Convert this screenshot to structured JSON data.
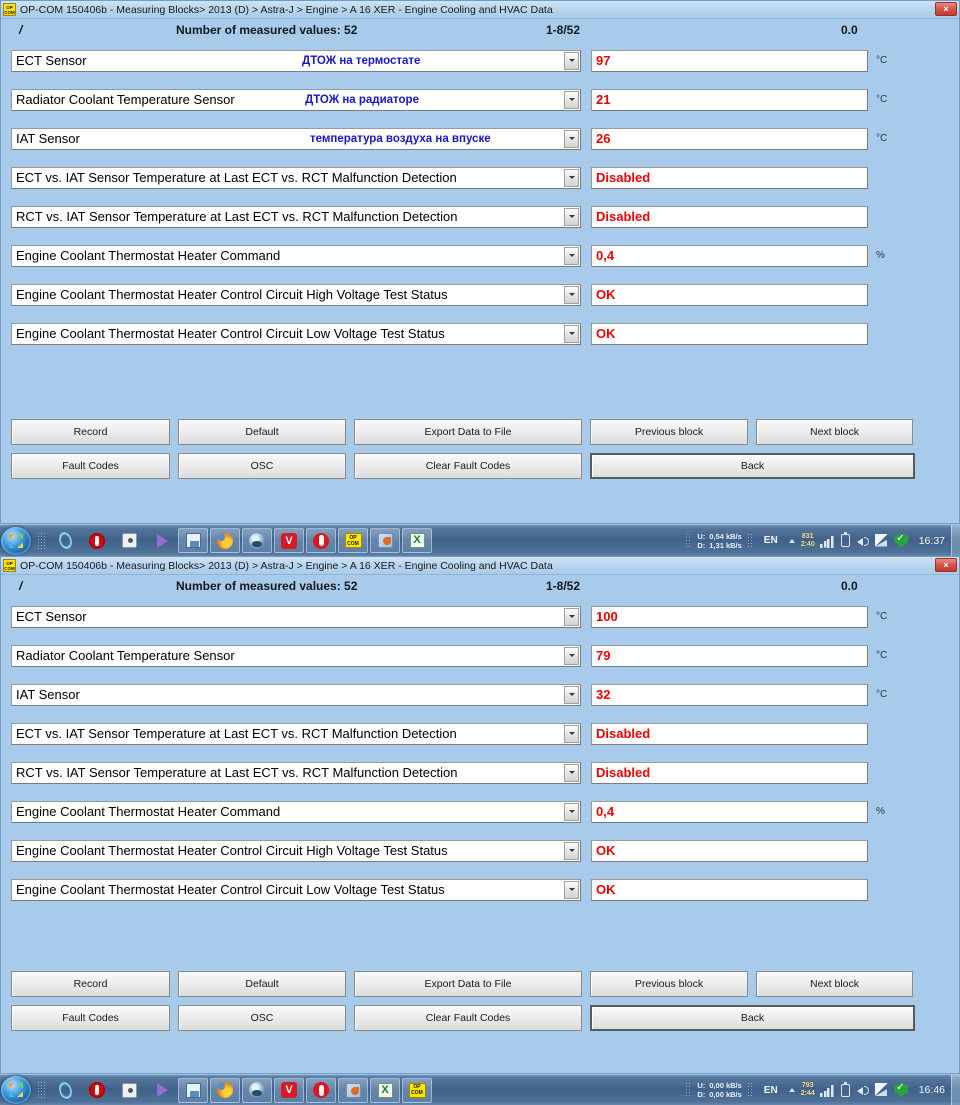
{
  "window": {
    "app_icon_text": [
      "OP",
      "COM"
    ],
    "title": "OP-COM 150406b - Measuring Blocks> 2013 (D) > Astra-J > Engine > A 16 XER - Engine Cooling and HVAC Data",
    "close_label": "×"
  },
  "header": {
    "slash": "/",
    "count_label": "Number of measured values: 52",
    "range": "1-8/52",
    "zero": "0.0"
  },
  "panel_top": {
    "rows": [
      {
        "label": "ECT Sensor",
        "note": "ДТОЖ на термостате",
        "value": "97",
        "unit": "°C"
      },
      {
        "label": "Radiator Coolant Temperature Sensor",
        "note": "ДТОЖ на радиаторе",
        "value": "21",
        "unit": "°C"
      },
      {
        "label": "IAT Sensor",
        "note": "температура воздуха на впуске",
        "value": "26",
        "unit": "°C"
      },
      {
        "label": "ECT vs. IAT Sensor Temperature at Last ECT vs. RCT Malfunction Detection",
        "note": "",
        "value": "Disabled",
        "unit": ""
      },
      {
        "label": "RCT vs. IAT Sensor Temperature at Last ECT vs. RCT Malfunction Detection",
        "note": "",
        "value": "Disabled",
        "unit": ""
      },
      {
        "label": "Engine Coolant Thermostat Heater Command",
        "note": "",
        "value": "0,4",
        "unit": "%"
      },
      {
        "label": "Engine Coolant Thermostat Heater Control Circuit High Voltage Test Status",
        "note": "",
        "value": "OK",
        "unit": ""
      },
      {
        "label": "Engine Coolant Thermostat Heater Control Circuit Low Voltage Test Status",
        "note": "",
        "value": "OK",
        "unit": ""
      }
    ]
  },
  "panel_bottom": {
    "rows": [
      {
        "label": "ECT Sensor",
        "note": "",
        "value": "100",
        "unit": "°C"
      },
      {
        "label": "Radiator Coolant Temperature Sensor",
        "note": "",
        "value": "79",
        "unit": "°C"
      },
      {
        "label": "IAT Sensor",
        "note": "",
        "value": "32",
        "unit": "°C"
      },
      {
        "label": "ECT vs. IAT Sensor Temperature at Last ECT vs. RCT Malfunction Detection",
        "note": "",
        "value": "Disabled",
        "unit": ""
      },
      {
        "label": "RCT vs. IAT Sensor Temperature at Last ECT vs. RCT Malfunction Detection",
        "note": "",
        "value": "Disabled",
        "unit": ""
      },
      {
        "label": "Engine Coolant Thermostat Heater Command",
        "note": "",
        "value": "0,4",
        "unit": "%"
      },
      {
        "label": "Engine Coolant Thermostat Heater Control Circuit High Voltage Test Status",
        "note": "",
        "value": "OK",
        "unit": ""
      },
      {
        "label": "Engine Coolant Thermostat Heater Control Circuit Low Voltage Test Status",
        "note": "",
        "value": "OK",
        "unit": ""
      }
    ]
  },
  "buttons": {
    "record": "Record",
    "default": "Default",
    "export": "Export Data to File",
    "previous_block": "Previous block",
    "next_block": "Next block",
    "fault_codes": "Fault Codes",
    "osc": "OSC",
    "clear_fault_codes": "Clear Fault Codes",
    "back": "Back"
  },
  "taskbar_top": {
    "icons": [
      "internet-explorer-icon",
      "opera-icon",
      "app-gray-icon",
      "media-player-icon",
      "save-icon",
      "firefox-icon",
      "browser-blue-icon",
      "vivaldi-icon",
      "opera-red-icon",
      "opcom-icon",
      "paint-icon",
      "excel-icon"
    ],
    "vivaldi_glyph": "V",
    "excel_glyph": "X",
    "opcom_glyph": [
      "OP",
      "COM"
    ],
    "tray": {
      "up_label": "U:",
      "down_label": "D:",
      "up_speed": "0,54 kB/s",
      "down_speed": "1,31 kB/s",
      "language": "EN",
      "counter_top": "831",
      "counter_bottom": "2:40",
      "clock": "16:37"
    }
  },
  "taskbar_bottom": {
    "icons": [
      "internet-explorer-icon",
      "opera-icon",
      "app-gray-icon",
      "media-player-icon",
      "save-icon",
      "firefox-icon",
      "browser-blue-icon",
      "vivaldi-icon",
      "opera-red-icon",
      "paint-icon",
      "excel-icon",
      "opcom-icon"
    ],
    "vivaldi_glyph": "V",
    "excel_glyph": "X",
    "opcom_glyph": [
      "OP",
      "COM"
    ],
    "tray": {
      "up_label": "U:",
      "down_label": "D:",
      "up_speed": "0,00 kB/s",
      "down_speed": "0,00 kB/s",
      "language": "EN",
      "counter_top": "793",
      "counter_bottom": "2:44",
      "clock": "16:46"
    }
  },
  "colors": {
    "window_bg": "#a8cbeb",
    "value_red": "#ee0000",
    "note_blue": "#1717c9"
  }
}
